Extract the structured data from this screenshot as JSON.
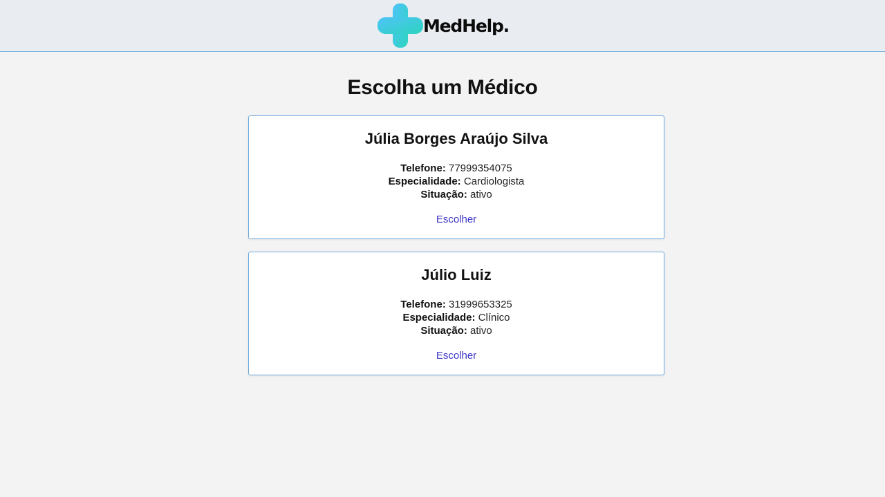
{
  "header": {
    "logo_text": "MedHelp.",
    "logo_icon": "medical-cross-icon",
    "colors": {
      "icon_gradient_start": "#4fc3f7",
      "icon_gradient_end": "#2dd4bf",
      "border": "#7fb7dc",
      "background": "#e9ecf1"
    }
  },
  "main": {
    "title": "Escolha um Médico",
    "doctors": [
      {
        "name": "Júlia Borges Araújo Silva",
        "phone_label": "Telefone:",
        "phone": "77999354075",
        "specialty_label": "Especialidade:",
        "specialty": "Cardiologista",
        "status_label": "Situação:",
        "status": "ativo",
        "choose_label": "Escolher"
      },
      {
        "name": "Júlio Luiz",
        "phone_label": "Telefone:",
        "phone": "31999653325",
        "specialty_label": "Especialidade:",
        "specialty": "Clínico",
        "status_label": "Situação:",
        "status": "ativo",
        "choose_label": "Escolher"
      }
    ]
  },
  "colors": {
    "link": "#3b35c7",
    "card_border": "#6fa8dc",
    "page_background": "#f3f3f4"
  }
}
